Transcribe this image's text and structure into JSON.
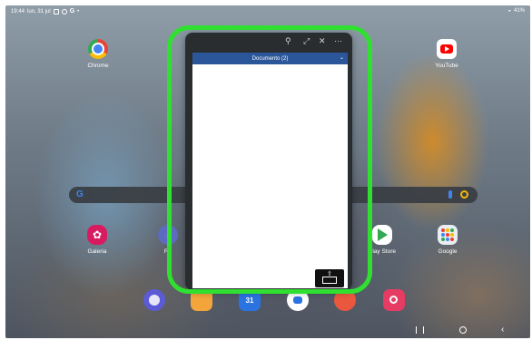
{
  "status_bar": {
    "time": "19:44",
    "date": "lun, 31 jul",
    "battery": "41%"
  },
  "apps_top": {
    "chrome_label": "Chrome",
    "youtube_label": "YouTube"
  },
  "apps_middle": {
    "galeria_label": "Galeria",
    "reloj_label": "Re",
    "playstore_label": "Play Store",
    "google_label": "Google"
  },
  "floating_window": {
    "title": "Documento (2)"
  },
  "dock": {
    "calendar_label": "31"
  },
  "colors": {
    "highlight": "#30e030",
    "word_blue": "#2b579a",
    "chrome_red": "#ea4335",
    "youtube_red": "#ff0000",
    "galeria_pink": "#d81b60",
    "playstore_white": "#ffffff"
  },
  "icons": {
    "status": [
      "gallery-icon",
      "settings-icon",
      "google-icon",
      "wifi-icon",
      "battery-icon"
    ],
    "floating_toolbar": [
      "pin-icon",
      "expand-icon",
      "close-icon",
      "more-icon"
    ],
    "navbar": [
      "recents-icon",
      "home-icon",
      "back-icon"
    ]
  }
}
